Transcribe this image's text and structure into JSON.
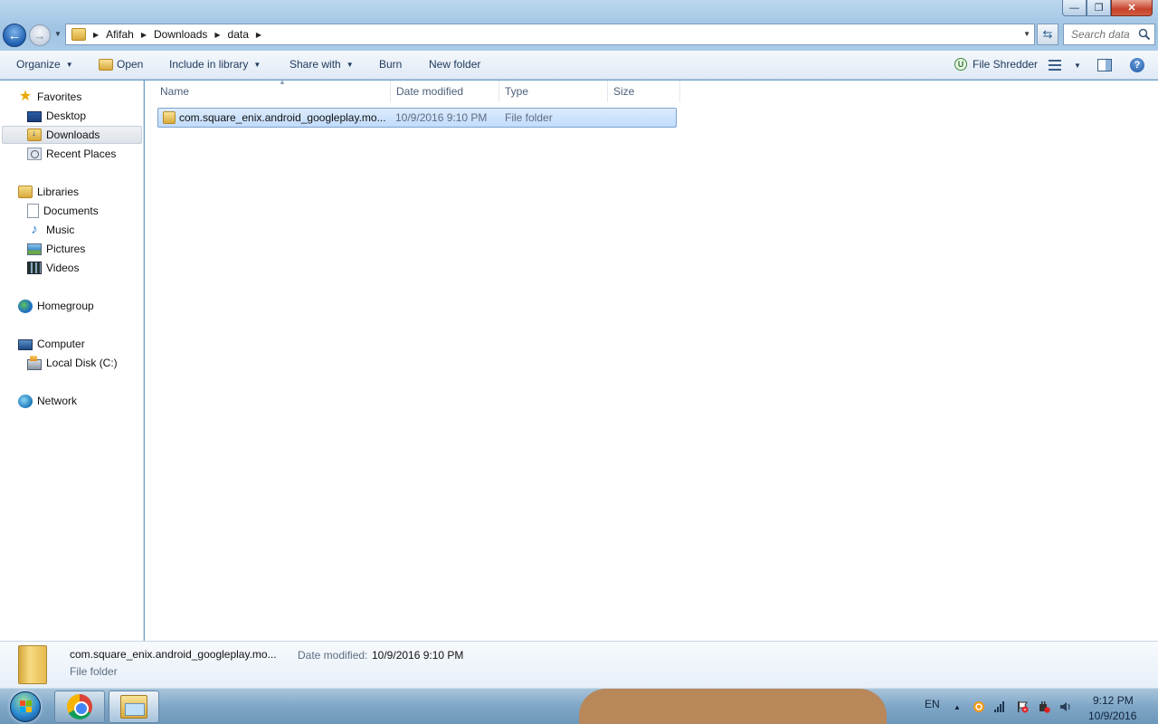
{
  "window": {
    "controls": {
      "minimize": "—",
      "maximize": "❐",
      "close": "✕"
    }
  },
  "address": {
    "crumbs": [
      "Afifah",
      "Downloads",
      "data"
    ],
    "search_placeholder": "Search data"
  },
  "toolbar": {
    "organize": "Organize",
    "open": "Open",
    "include_in_library": "Include in library",
    "share_with": "Share with",
    "burn": "Burn",
    "new_folder": "New folder",
    "file_shredder": "File Shredder"
  },
  "nav": {
    "favorites": "Favorites",
    "desktop": "Desktop",
    "downloads": "Downloads",
    "recent_places": "Recent Places",
    "libraries": "Libraries",
    "documents": "Documents",
    "music": "Music",
    "pictures": "Pictures",
    "videos": "Videos",
    "homegroup": "Homegroup",
    "computer": "Computer",
    "local_disk": "Local Disk (C:)",
    "network": "Network"
  },
  "columns": {
    "name": "Name",
    "date_modified": "Date modified",
    "type": "Type",
    "size": "Size"
  },
  "files": [
    {
      "name": "com.square_enix.android_googleplay.mo...",
      "date_modified": "10/9/2016 9:10 PM",
      "type": "File folder",
      "size": ""
    }
  ],
  "details": {
    "name": "com.square_enix.android_googleplay.mo...",
    "date_label": "Date modified:",
    "date_value": "10/9/2016 9:10 PM",
    "type": "File folder"
  },
  "taskbar": {
    "language": "EN",
    "time": "9:12 PM",
    "date": "10/9/2016"
  },
  "colors": {
    "selection": "#cce4fc",
    "selection_border": "#7da2ce",
    "toolbar_text": "#1e395b"
  }
}
